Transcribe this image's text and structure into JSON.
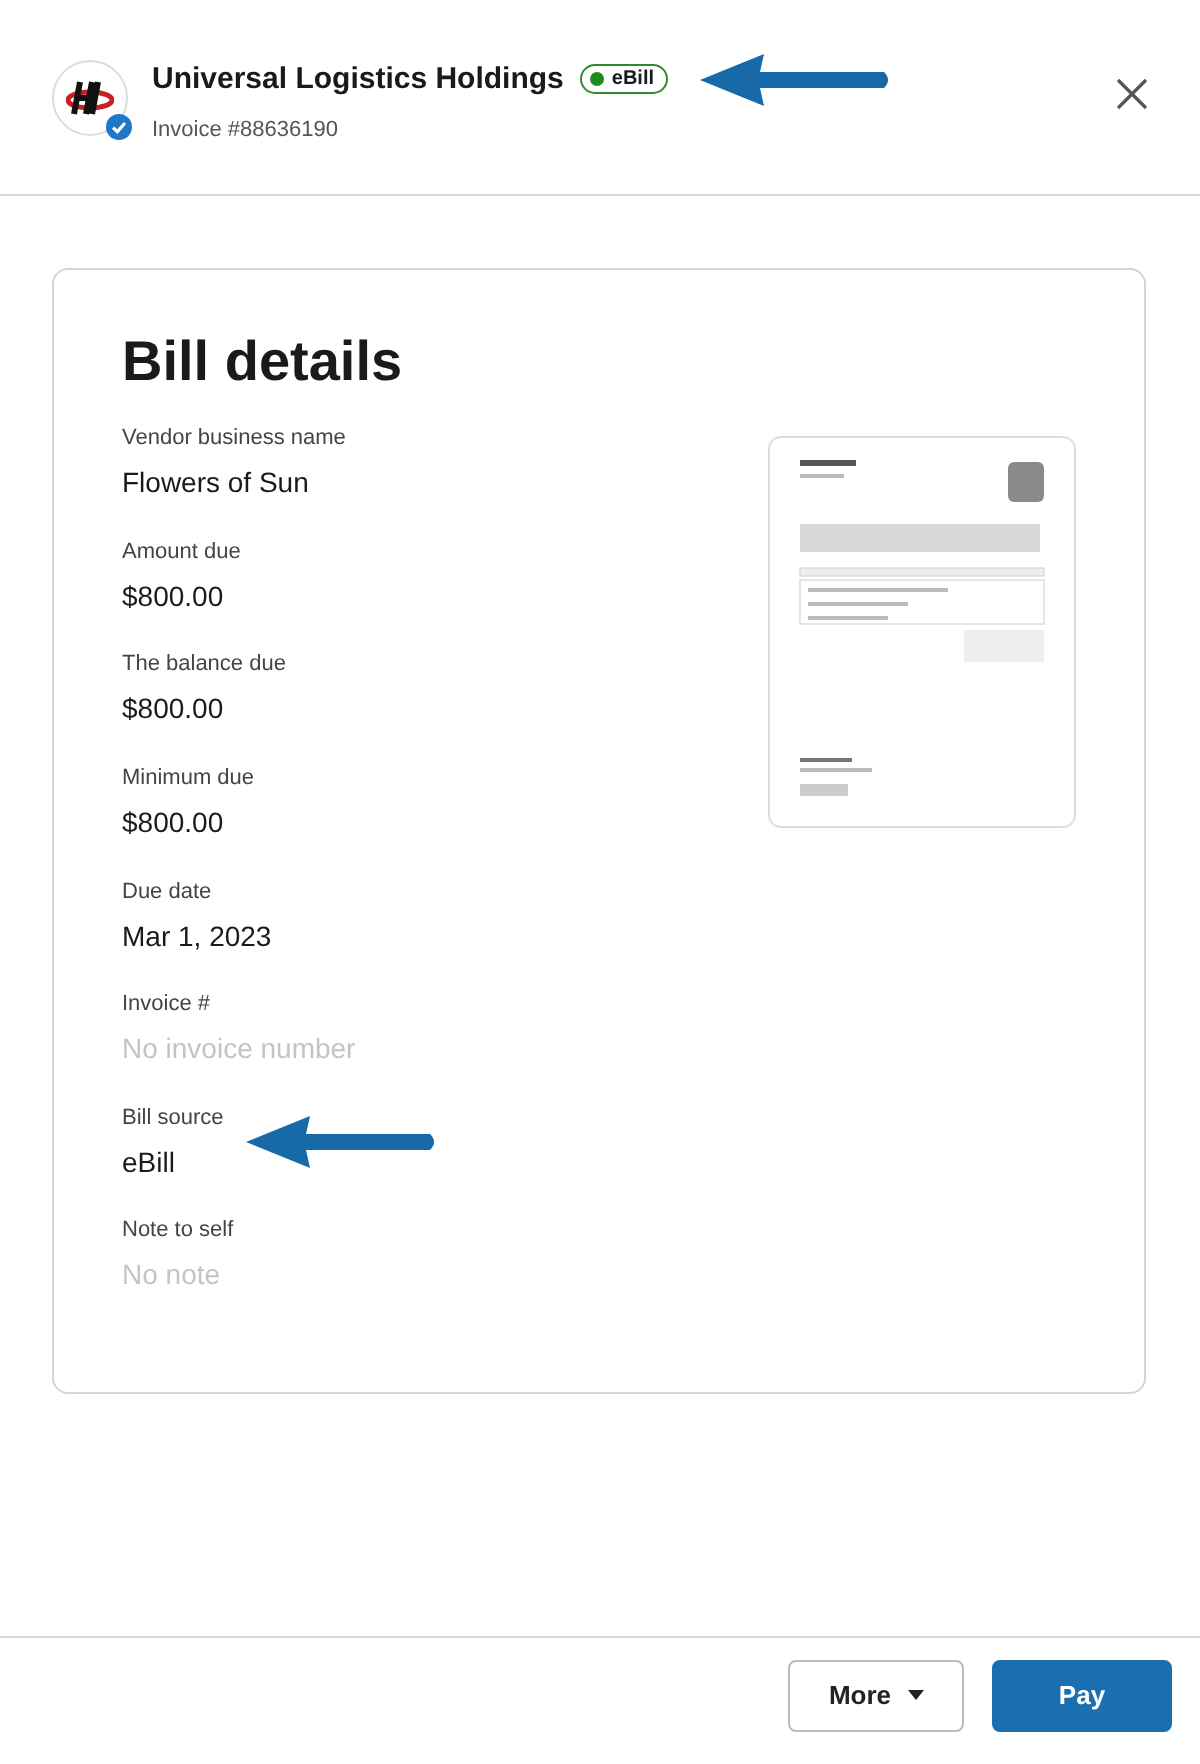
{
  "header": {
    "vendor": "Universal Logistics Holdings",
    "badge": "eBill",
    "invoice": "Invoice #88636190",
    "verified": true
  },
  "card": {
    "title": "Bill details",
    "fields": [
      {
        "label": "Vendor business name",
        "value": "Flowers of Sun",
        "empty": false
      },
      {
        "label": "Amount due",
        "value": "$800.00",
        "empty": false
      },
      {
        "label": "The balance due",
        "value": "$800.00",
        "empty": false
      },
      {
        "label": "Minimum due",
        "value": "$800.00",
        "empty": false
      },
      {
        "label": "Due date",
        "value": "Mar 1, 2023",
        "empty": false
      },
      {
        "label": "Invoice #",
        "value": "No invoice number",
        "empty": true
      },
      {
        "label": "Bill source",
        "value": "eBill",
        "empty": false,
        "arrow": true
      },
      {
        "label": "Note to self",
        "value": "No note",
        "empty": true
      }
    ]
  },
  "footer": {
    "buttons": [
      {
        "label": "More",
        "kind": "menu"
      },
      {
        "label": "Pay",
        "kind": "primary"
      }
    ]
  }
}
